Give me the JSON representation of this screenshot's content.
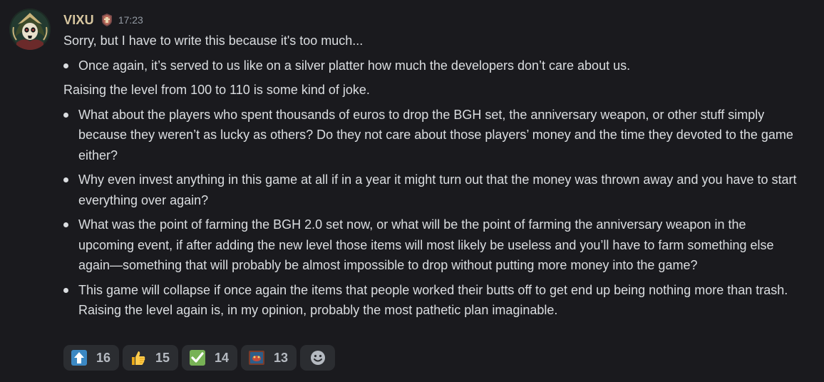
{
  "message": {
    "username": "VIXU",
    "timestamp": "17:23",
    "avatar_icon": "pirate-skull-avatar",
    "badge_icon": "guild-badge-icon",
    "intro": "Sorry, but I have to write this because it's too much...",
    "bullets_1": [
      "Once again, it’s served to us like on a silver platter how much the developers don’t care about us."
    ],
    "middle": "Raising the level from 100 to 110 is some kind of joke.",
    "bullets_2": [
      "What about the players who spent thousands of euros to drop the BGH set, the anniversary weapon, or other stuff simply because they weren’t as lucky as others? Do they not care about those players’ money and the time they devoted to the game either?",
      "Why even invest anything in this game at all if in a year it might turn out that the money was thrown away and you have to start everything over again?",
      "What was the point of farming the BGH 2.0 set now, or what will be the point of farming the anniversary weapon in the upcoming event, if after adding the new level those items will most likely be useless and you’ll have to farm something else again—something that will probably be almost impossible to drop without putting more money into the game?",
      "This game will collapse if once again the items that people worked their butts off to get end up being nothing more than trash. Raising the level again is, in my opinion, probably the most pathetic plan imaginable."
    ]
  },
  "reactions": [
    {
      "emoji": "up-arrow-icon",
      "count": "16"
    },
    {
      "emoji": "thumbs-up-icon",
      "count": "15"
    },
    {
      "emoji": "check-mark-icon",
      "count": "14"
    },
    {
      "emoji": "custom-emoji-icon",
      "count": "13"
    }
  ],
  "add_reaction_icon": "smiley-add-reaction-icon",
  "colors": {
    "background": "#1a1a1e",
    "username": "#d8c7a0",
    "text": "#dbdee1",
    "timestamp": "#949ba4",
    "reaction_bg": "#2b2d31"
  }
}
